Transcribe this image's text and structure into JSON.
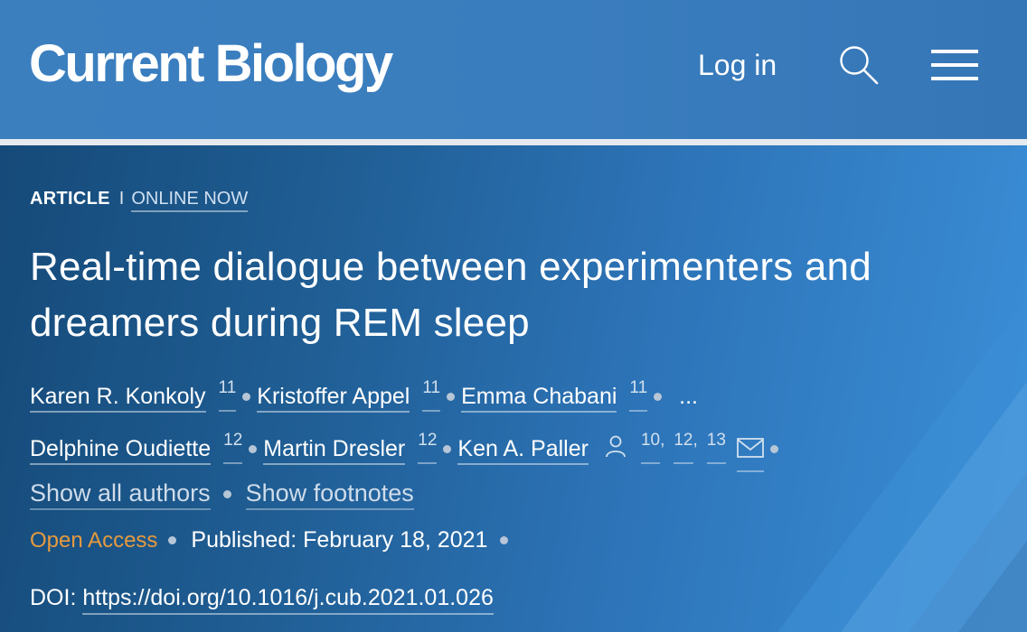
{
  "header": {
    "logo": "Current Biology",
    "login_label": "Log in"
  },
  "article": {
    "type": "ARTICLE",
    "separator": "I",
    "status": "ONLINE NOW",
    "title": "Real-time dialogue between experimenters and dreamers during REM sleep",
    "authors_row1": [
      {
        "name": "Karen R. Konkoly",
        "aff": "11"
      },
      {
        "name": "Kristoffer Appel",
        "aff": "11"
      },
      {
        "name": "Emma Chabani",
        "aff": "11"
      }
    ],
    "ellipsis": "...",
    "authors_row2": [
      {
        "name": "Delphine Oudiette",
        "aff": "12"
      },
      {
        "name": "Martin Dresler",
        "aff": "12"
      }
    ],
    "last_author": {
      "name": "Ken A. Paller",
      "affs": [
        "10",
        "12",
        "13"
      ]
    },
    "comma": ",",
    "show_all_authors": "Show all authors",
    "show_footnotes": "Show footnotes",
    "open_access": "Open Access",
    "published_label": "Published:",
    "published_date": "February 18, 2021",
    "doi_label": "DOI:",
    "doi_url": "https://doi.org/10.1016/j.cub.2021.01.026"
  },
  "colors": {
    "header_bg": "#3b7fbf",
    "hero_dark": "#154a79",
    "hero_light": "#3b8fd8",
    "open_access": "#e59a3f"
  },
  "icons": [
    "search-icon",
    "menu-icon",
    "person-icon",
    "mail-icon"
  ]
}
